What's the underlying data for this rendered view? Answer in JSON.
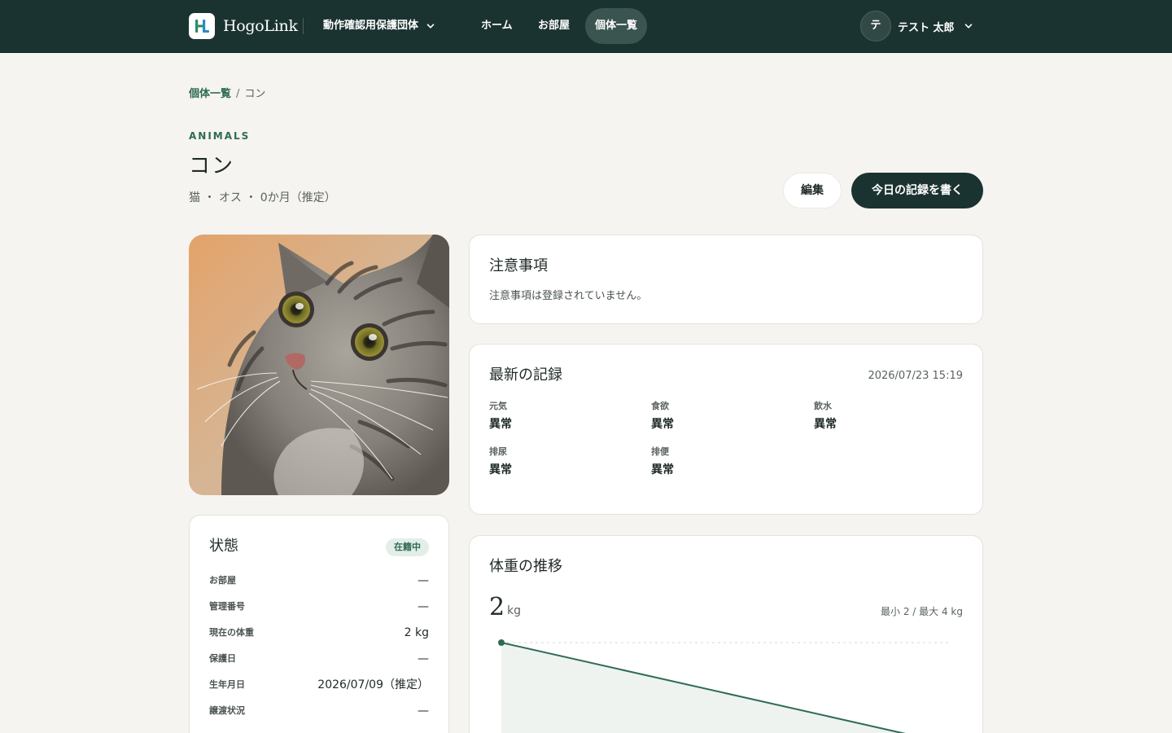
{
  "header": {
    "logo_text": "HogoLink",
    "org_name": "動作確認用保護団体",
    "nav": [
      "ホーム",
      "お部屋",
      "個体一覧"
    ],
    "user_initial": "テ",
    "user_name": "テスト 太郎"
  },
  "breadcrumb": {
    "parent": "個体一覧",
    "separator": "/",
    "current": "コン"
  },
  "page": {
    "eyebrow": "ANIMALS",
    "title": "コン",
    "subtitle": "猫 ・ オス ・ 0か月（推定）",
    "edit_label": "編集",
    "record_label": "今日の記録を書く"
  },
  "notes": {
    "title": "注意事項",
    "body": "注意事項は登録されていません。"
  },
  "latest": {
    "title": "最新の記録",
    "timestamp": "2026/07/23 15:19",
    "metrics": [
      {
        "label": "元気",
        "value": "異常"
      },
      {
        "label": "食欲",
        "value": "異常"
      },
      {
        "label": "飲水",
        "value": "異常"
      },
      {
        "label": "排尿",
        "value": "異常"
      },
      {
        "label": "排便",
        "value": "異常"
      }
    ]
  },
  "status": {
    "title": "状態",
    "badge": "在籍中",
    "rows": [
      {
        "key": "お部屋",
        "value": "—"
      },
      {
        "key": "管理番号",
        "value": "—"
      },
      {
        "key": "現在の体重",
        "value": "2 kg"
      },
      {
        "key": "保護日",
        "value": "—"
      },
      {
        "key": "生年月日",
        "value": "2026/07/09（推定）"
      },
      {
        "key": "譲渡状況",
        "value": "—"
      }
    ]
  },
  "weight": {
    "title": "体重の推移",
    "current_value": "2",
    "unit": "kg",
    "range_text": "最小 2 / 最大 4 kg"
  },
  "chart_data": {
    "type": "area",
    "series": [
      {
        "values": [
          4,
          2
        ]
      }
    ],
    "ylim": [
      2,
      4
    ]
  },
  "colors": {
    "header_bg": "#1b3330",
    "accent": "#2e6b55",
    "page_bg": "#f5f4f0"
  }
}
